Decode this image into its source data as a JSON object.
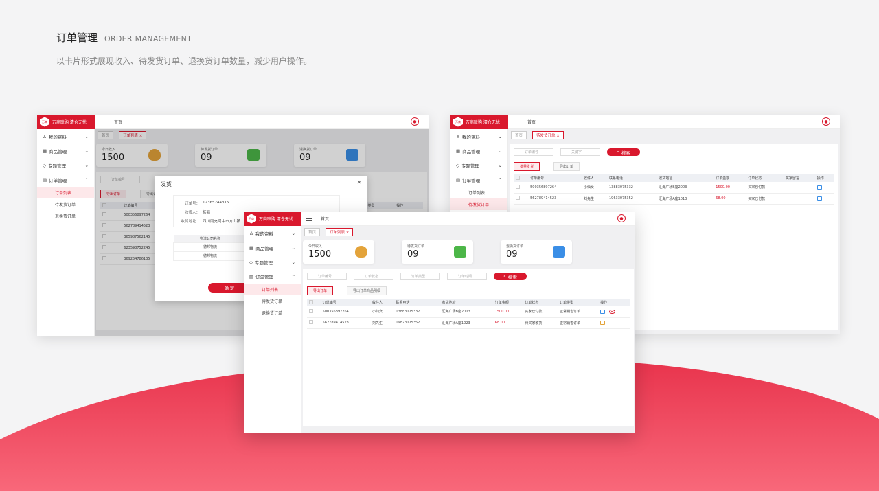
{
  "header": {
    "title": "订单管理",
    "title_en": "ORDER MANAGEMENT",
    "subtitle": "以卡片形式展现收入、待发货订单、退换货订单数量，减少用户操作。"
  },
  "app": {
    "logo_badge": "万商",
    "brand": "万商联购  清仓无忧",
    "home": "首页"
  },
  "sidebar": {
    "items": [
      {
        "label": "我的资料",
        "icon": "user-icon"
      },
      {
        "label": "商品管理",
        "icon": "grid-icon"
      },
      {
        "label": "专题管理",
        "icon": "tag-icon"
      },
      {
        "label": "订单管理",
        "icon": "document-icon"
      }
    ],
    "subs": [
      "订单列表",
      "待发货订单",
      "退换货订单"
    ]
  },
  "tabs": {
    "home": "首页",
    "list": "订单列表 ×",
    "pending": "待发货订单 ×"
  },
  "cards": [
    {
      "label": "今日收入",
      "value": "1500",
      "icon": "money-bag-icon",
      "color": "#e3a33a"
    },
    {
      "label": "待发货订单",
      "value": "09",
      "icon": "truck-icon",
      "color": "#4cb648"
    },
    {
      "label": "退换货订单",
      "value": "09",
      "icon": "return-box-icon",
      "color": "#3a8ee6"
    }
  ],
  "filters": {
    "order_no": "订单编号",
    "status": "订单状态",
    "type": "订单类型",
    "time": "订单时间",
    "keyword": "关键字",
    "search": "搜索"
  },
  "buttons": {
    "export": "导出订单",
    "export_items": "导出订单商品明细",
    "batch_ship": "批量发货"
  },
  "table": {
    "headers": [
      "订单编号",
      "收件人",
      "联系电话",
      "收货地址",
      "订单金额",
      "订单状态",
      "订单类型",
      "操作"
    ],
    "rows": [
      {
        "no": "500356897264",
        "name": "小仙女",
        "phone": "13883075332",
        "addr": "汇海广场B座2003",
        "amount": "1500.00",
        "status": "买家已付款",
        "type": "正常销售订单"
      },
      {
        "no": "562789414523",
        "name": "刘先生",
        "phone": "19823075352",
        "addr": "汇海广场A座1023",
        "amount": "68.00",
        "status": "待买家收货",
        "type": "正常销售订单"
      }
    ]
  },
  "w2": {
    "headers": [
      "订单编号",
      "收件人",
      "联系电话",
      "收货地址",
      "订单金额",
      "订单状态",
      "买家留言",
      "操作"
    ],
    "rows": [
      {
        "no": "500356897264",
        "name": "小仙女",
        "phone": "13883075332",
        "addr": "汇海广场B座2003",
        "amount": "1500.00",
        "status": "买家已付款"
      },
      {
        "no": "562789414523",
        "name": "刘先生",
        "phone": "19633075352",
        "addr": "汇海广场A座1013",
        "amount": "68.00",
        "status": "买家已付款"
      }
    ]
  },
  "w1": {
    "header_no": "订单编号",
    "header_extra": "类型",
    "header_op": "操作",
    "export_other": "导出订",
    "orders": [
      "500356897264",
      "562789414523",
      "365987562145",
      "623598752245",
      "369254786135"
    ]
  },
  "dialog": {
    "title": "发货",
    "close": "×",
    "fields": [
      {
        "k": "订单号：",
        "v": "12365244315"
      },
      {
        "k": "收货人：",
        "v": "杨丽"
      },
      {
        "k": "收货地址：",
        "v": "四川南充阆中市方山镇"
      }
    ],
    "table_header": "物流公司名称",
    "logistics": [
      "德邦物流",
      "德邦物流"
    ],
    "ok": "确 定"
  }
}
